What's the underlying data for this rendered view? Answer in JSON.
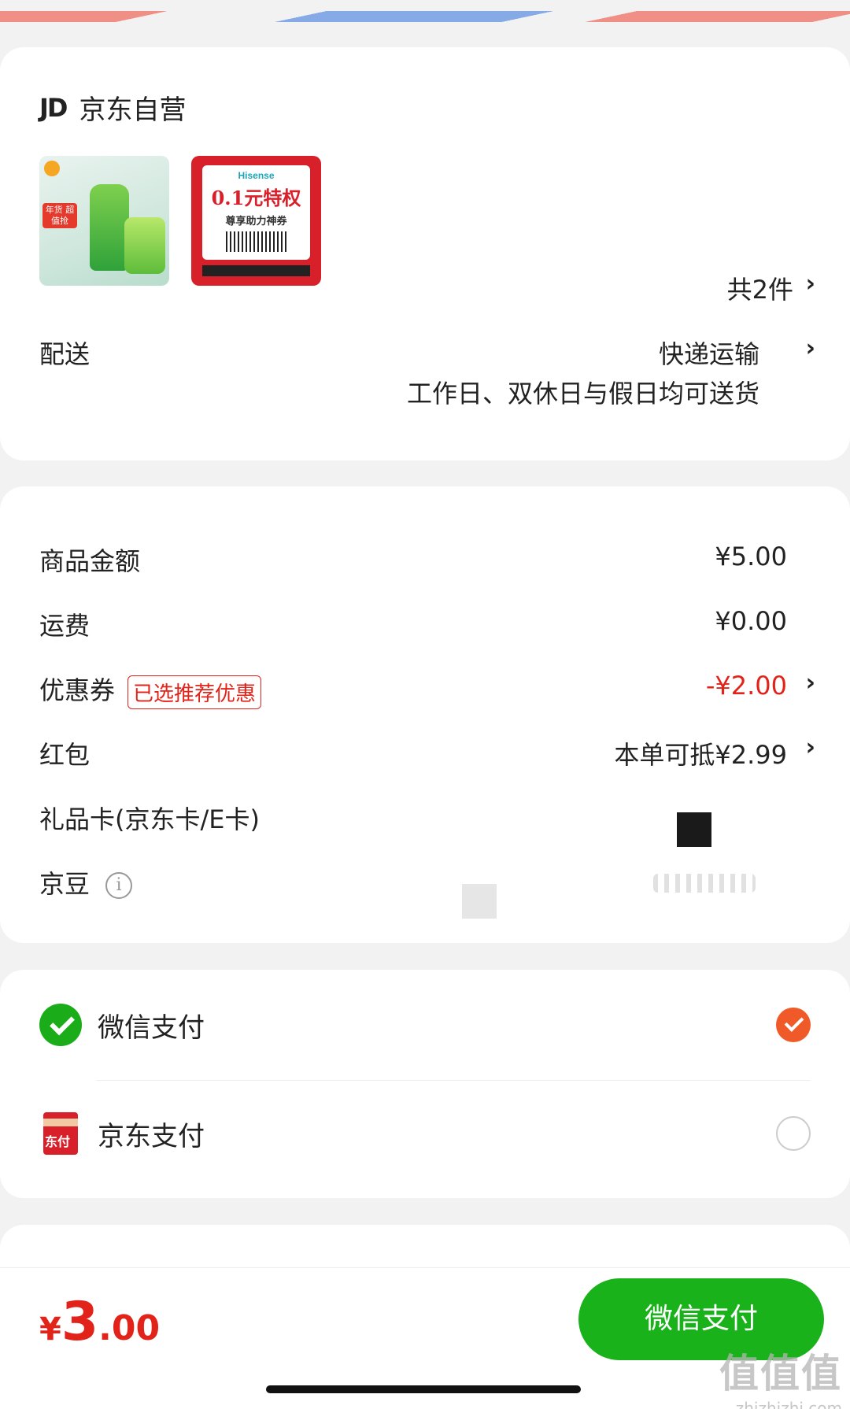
{
  "shop": {
    "logo": "JD",
    "name": "京东自营",
    "count": "共2件",
    "thumb2": {
      "brand": "Hisense",
      "big": "0.1元特权",
      "sub": "尊享助力神券"
    },
    "thumb1": {
      "tag": "年货 超值抢"
    }
  },
  "delivery": {
    "label": "配送",
    "method": "快递运输",
    "note": "工作日、双休日与假日均可送货"
  },
  "price": {
    "goods_label": "商品金额",
    "goods_value": "¥5.00",
    "freight_label": "运费",
    "freight_value": "¥0.00",
    "coupon_label": "优惠券",
    "coupon_tag": "已选推荐优惠",
    "coupon_value": "-¥2.00",
    "redpacket_label": "红包",
    "redpacket_value": "本单可抵¥2.99",
    "giftcard_label": "礼品卡(京东卡/E卡)",
    "jingdou_label": "京豆"
  },
  "payment": {
    "wechat_label": "微信支付",
    "jdpay_label": "京东支付",
    "jdpay_icon_text": "东付",
    "selected": "wechat"
  },
  "footer": {
    "currency": "¥",
    "total_int": "3",
    "total_dec": ".00",
    "pay_button": "微信支付"
  },
  "watermark": {
    "big": "值值值",
    "small": "zhizhizhi.com"
  },
  "colors": {
    "accent_red": "#e2231a",
    "wechat_green": "#19b21a",
    "radio_orange": "#f05a28"
  }
}
